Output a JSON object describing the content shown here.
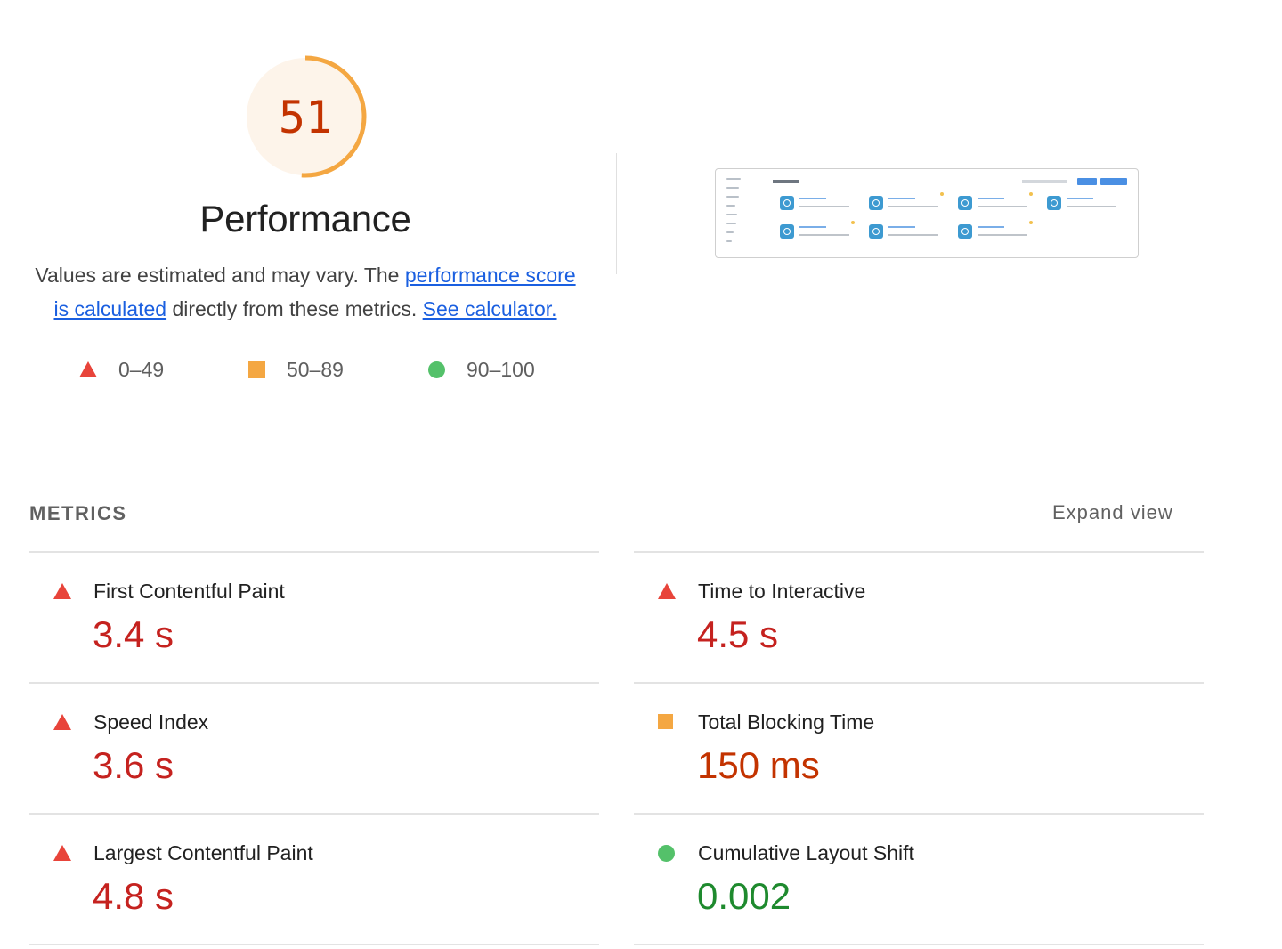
{
  "gauge": {
    "score": "51",
    "score_fraction": 0.51,
    "title": "Performance",
    "color": "#f4a742",
    "bg_color": "#fdf4ea"
  },
  "description": {
    "text_before": "Values are estimated and may vary. The ",
    "link_score": "performance score is calculated",
    "text_middle": " directly from these metrics. ",
    "link_calculator": "See calculator."
  },
  "legend": [
    {
      "icon": "triangle-icon",
      "label": "0–49"
    },
    {
      "icon": "square-icon",
      "label": "50–89"
    },
    {
      "icon": "circle-icon",
      "label": "90–100"
    }
  ],
  "metrics": {
    "header": "METRICS",
    "expand_label": "Expand view",
    "items": [
      {
        "name": "First Contentful Paint",
        "value": "3.4 s",
        "rating": "fail"
      },
      {
        "name": "Time to Interactive",
        "value": "4.5 s",
        "rating": "fail"
      },
      {
        "name": "Speed Index",
        "value": "3.6 s",
        "rating": "fail"
      },
      {
        "name": "Total Blocking Time",
        "value": "150 ms",
        "rating": "average"
      },
      {
        "name": "Largest Contentful Paint",
        "value": "4.8 s",
        "rating": "fail"
      },
      {
        "name": "Cumulative Layout Shift",
        "value": "0.002",
        "rating": "pass"
      }
    ]
  },
  "colors": {
    "fail": "#e8443a",
    "average": "#f4a742",
    "pass": "#54c16a"
  }
}
